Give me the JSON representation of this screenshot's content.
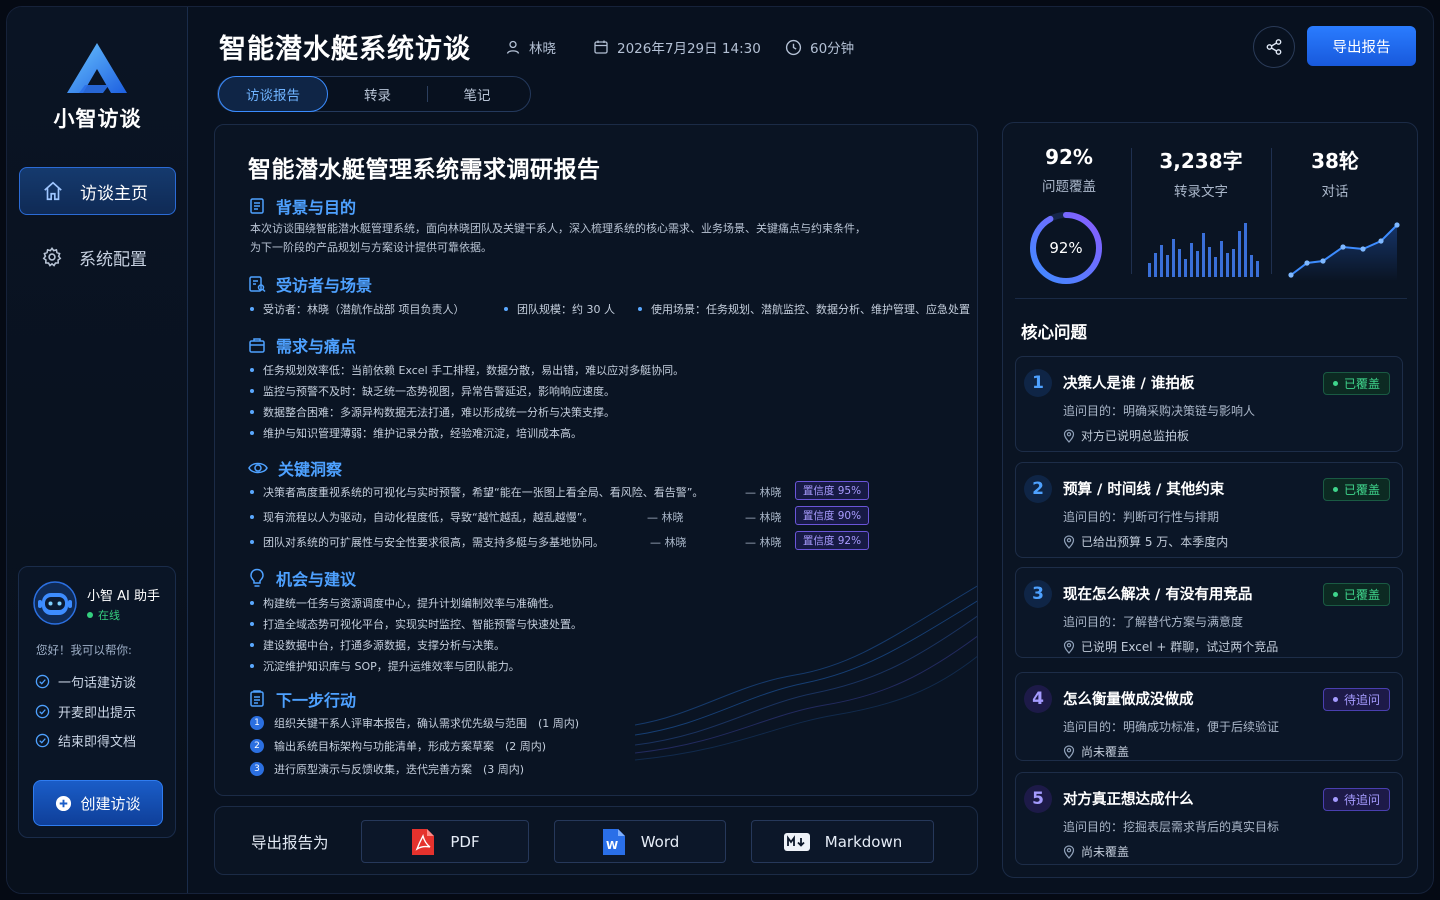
{
  "app": {
    "brand": "小智访谈"
  },
  "sidebar": {
    "items": [
      {
        "label": "访谈主页",
        "icon": "home-icon"
      },
      {
        "label": "系统配置",
        "icon": "gear-icon"
      }
    ],
    "assistant": {
      "name": "小智 AI 助手",
      "status": "在线",
      "greeting": "您好！我可以帮你:",
      "features": [
        "一句话建访谈",
        "开麦即出提示",
        "结束即得文档"
      ],
      "create_label": "创建访谈"
    }
  },
  "header": {
    "title": "智能潜水艇系统访谈",
    "interviewee": "林晓",
    "datetime": "2026年7月29日 14:30",
    "duration": "60分钟",
    "tabs": [
      "访谈报告",
      "转录",
      "笔记"
    ],
    "active_tab": 0,
    "export_label": "导出报告"
  },
  "report": {
    "title": "智能潜水艇管理系统需求调研报告",
    "sections": {
      "background": {
        "heading": "背景与目的",
        "text1": "本次访谈围绕智能潜水艇管理系统，面向林晓团队及关键干系人，深入梳理系统的核心需求、业务场景、关键痛点与约束条件，",
        "text2": "为下一阶段的产品规划与方案设计提供可靠依据。"
      },
      "interviewee": {
        "heading": "受访者与场景",
        "items": [
          "受访者：林晓（潜航作战部 项目负责人）",
          "团队规模：约 30 人",
          "使用场景：任务规划、潜航监控、数据分析、维护管理、应急处置"
        ]
      },
      "needs": {
        "heading": "需求与痛点",
        "items": [
          "任务规划效率低：当前依赖 Excel 手工排程，数据分散，易出错，难以应对多艇协同。",
          "监控与预警不及时：缺乏统一态势视图，异常告警延迟，影响响应速度。",
          "数据整合困难：多源异构数据无法打通，难以形成统一分析与决策支撑。",
          "维护与知识管理薄弱：维护记录分散，经验难沉淀，培训成本高。"
        ]
      },
      "insights": {
        "heading": "关键洞察",
        "items": [
          {
            "text": "决策者高度重视系统的可视化与实时预警，希望“能在一张图上看全局、看风险、看告警”。",
            "by": "— 林晓",
            "conf": "置信度 95%"
          },
          {
            "text": "现有流程以人为驱动，自动化程度低，导致“越忙越乱，越乱越慢”。",
            "by": "— 林晓",
            "by2": "— 林晓",
            "conf": "置信度 90%"
          },
          {
            "text": "团队对系统的可扩展性与安全性要求很高，需支持多艇与多基地协同。",
            "by": "— 林晓",
            "by2": "— 林晓",
            "conf": "置信度 92%"
          }
        ]
      },
      "opportunities": {
        "heading": "机会与建议",
        "items": [
          "构建统一任务与资源调度中心，提升计划编制效率与准确性。",
          "打造全域态势可视化平台，实现实时监控、智能预警与快速处置。",
          "建设数据中台，打通多源数据，支撑分析与决策。",
          "沉淀维护知识库与 SOP，提升运维效率与团队能力。"
        ]
      },
      "next": {
        "heading": "下一步行动",
        "items": [
          {
            "n": "1",
            "text": "组织关键干系人评审本报告，确认需求优先级与范围　(1 周内)"
          },
          {
            "n": "2",
            "text": "输出系统目标架构与功能清单，形成方案草案　(2 周内)"
          },
          {
            "n": "3",
            "text": "进行原型演示与反馈收集，迭代完善方案　(3 周内)"
          }
        ]
      }
    }
  },
  "export": {
    "label": "导出报告为",
    "formats": [
      "PDF",
      "Word",
      "Markdown"
    ]
  },
  "stats": {
    "coverage": {
      "value": "92%",
      "label": "问题覆盖",
      "ring": "92%",
      "fraction": 0.92
    },
    "words": {
      "value": "3,238字",
      "label": "转录文字"
    },
    "turns": {
      "value": "38轮",
      "label": "对话"
    }
  },
  "core": {
    "title": "核心问题",
    "questions": [
      {
        "n": "1",
        "title": "决策人是谁 / 谁拍板",
        "purpose": "追问目的：明确采购决策链与影响人",
        "answer": "对方已说明总监拍板",
        "status": "已覆盖",
        "state": "ok"
      },
      {
        "n": "2",
        "title": "预算 / 时间线 / 其他约束",
        "purpose": "追问目的：判断可行性与排期",
        "answer": "已给出预算 5 万、本季度内",
        "status": "已覆盖",
        "state": "ok"
      },
      {
        "n": "3",
        "title": "现在怎么解决 / 有没有用竞品",
        "purpose": "追问目的：了解替代方案与满意度",
        "answer": "已说明 Excel + 群聊，试过两个竞品",
        "status": "已覆盖",
        "state": "ok"
      },
      {
        "n": "4",
        "title": "怎么衡量做成没做成",
        "purpose": "追问目的：明确成功标准，便于后续验证",
        "answer": "尚未覆盖",
        "status": "待追问",
        "state": "wait"
      },
      {
        "n": "5",
        "title": "对方真正想达成什么",
        "purpose": "追问目的：挖掘表层需求背后的真实目标",
        "answer": "尚未覆盖",
        "status": "待追问",
        "state": "wait"
      }
    ]
  },
  "colors": {
    "accent": "#2a7cff",
    "covered": "#3fd58c",
    "pending": "#a59bff"
  }
}
